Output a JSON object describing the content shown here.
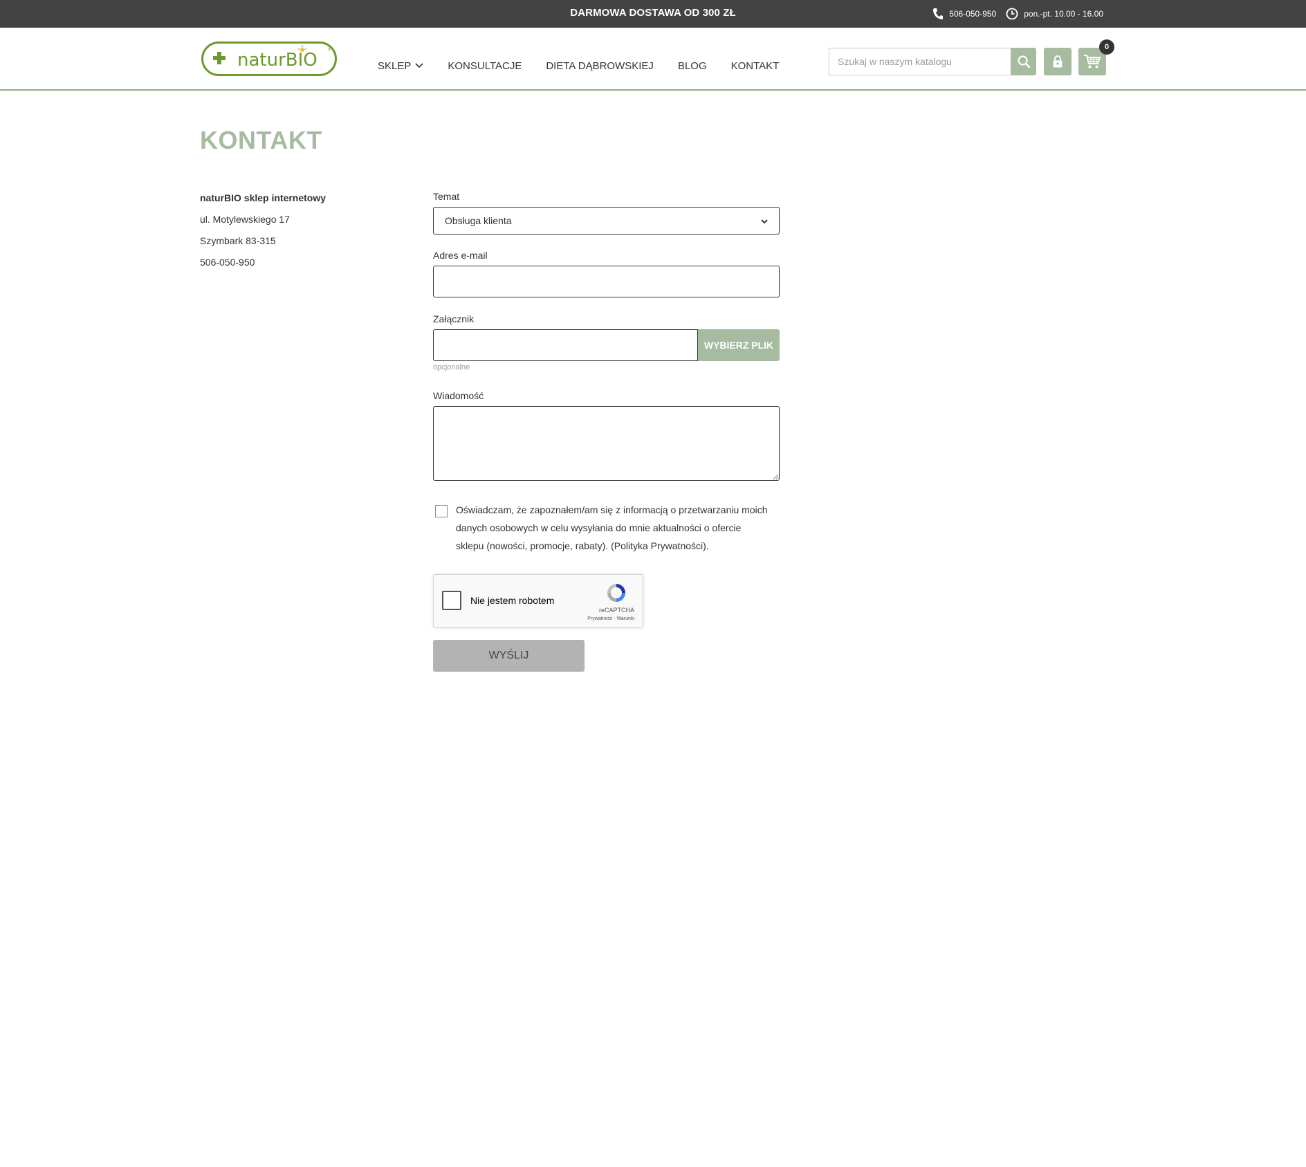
{
  "topbar": {
    "promo": "DARMOWA DOSTAWA OD 300 ZŁ",
    "phone": "506-050-950",
    "hours": "pon.-pt. 10.00 - 16.00"
  },
  "header": {
    "logo_text": "naturBIO",
    "nav": [
      {
        "label": "SKLEP"
      },
      {
        "label": "KONSULTACJE"
      },
      {
        "label": "DIETA DĄBROWSKIEJ"
      },
      {
        "label": "BLOG"
      },
      {
        "label": "KONTAKT"
      }
    ],
    "search_placeholder": "Szukaj w naszym katalogu",
    "cart_count": "0"
  },
  "page": {
    "title": "KONTAKT"
  },
  "address": {
    "name": "naturBIO sklep internetowy",
    "street": "ul. Motylewskiego 17",
    "city": "Szymbark 83-315",
    "phone": "506-050-950"
  },
  "form": {
    "subject_label": "Temat",
    "subject_value": "Obsługa klienta",
    "email_label": "Adres e-mail",
    "email_value": "",
    "attachment_label": "Załącznik",
    "attachment_button": "WYBIERZ PLIK",
    "attachment_hint": "opcjonalne",
    "message_label": "Wiadomość",
    "consent_text": "Oświadczam, że zapoznałem/am się z informacją o  przetwarzaniu moich danych osobowych w celu wysyłania do mnie aktualności o ofercie sklepu (nowości, promocje, rabaty). (Polityka Prywatności).",
    "captcha_label": "Nie jestem robotem",
    "captcha_brand": "reCAPTCHA",
    "captcha_links": "Prywatność - Warunki",
    "submit_label": "WYŚLIJ"
  },
  "colors": {
    "topbar_bg": "#434343",
    "accent": "#a6bba0",
    "logo_green": "#6c9a2f",
    "submit_bg": "#b3b3b3"
  }
}
